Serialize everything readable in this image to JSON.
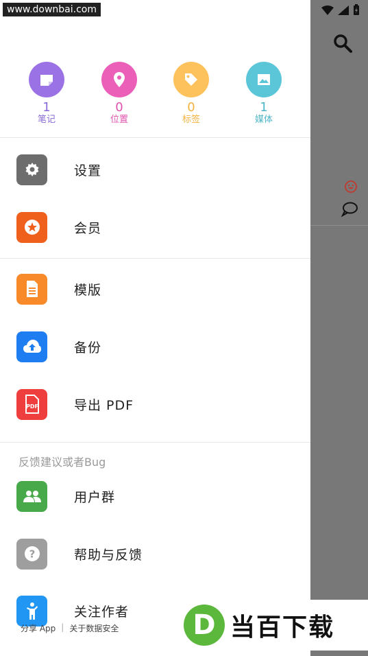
{
  "watermark": "www.downbai.com",
  "stats": [
    {
      "value": "1",
      "label": "笔记",
      "color": "#9b72e6",
      "text_color": "#8a6ad8",
      "icon": "note-icon"
    },
    {
      "value": "0",
      "label": "位置",
      "color": "#ec5fb8",
      "text_color": "#e053ad",
      "icon": "location-pin-icon"
    },
    {
      "value": "0",
      "label": "标签",
      "color": "#fdc25b",
      "text_color": "#f4b23f",
      "icon": "tag-icon"
    },
    {
      "value": "1",
      "label": "媒体",
      "color": "#5bc6d8",
      "text_color": "#4cb6c8",
      "icon": "image-icon"
    }
  ],
  "menu": {
    "settings": "设置",
    "membership": "会员",
    "templates": "模版",
    "backup": "备份",
    "export_pdf": "导出 PDF",
    "feedback_header": "反馈建议或者Bug",
    "user_group": "用户群",
    "help_feedback": "帮助与反馈",
    "follow_author": "关注作者"
  },
  "icon_colors": {
    "settings": "#6d6d6d",
    "membership": "#f0601d",
    "templates": "#f98a2a",
    "backup": "#1e7df0",
    "export_pdf": "#ee3e3e",
    "user_group": "#47a94a",
    "help_feedback": "#9e9e9e",
    "follow_author": "#2196f3"
  },
  "footer": {
    "share": "分享 App",
    "separator": "|",
    "data_security": "关于数据安全"
  },
  "logo": {
    "letter": "D",
    "text": "当百下载"
  }
}
